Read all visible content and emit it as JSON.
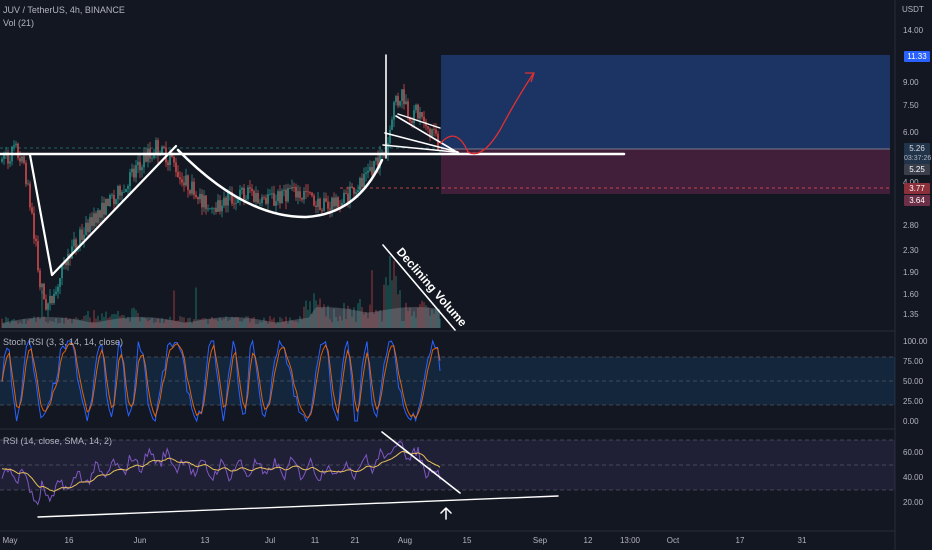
{
  "header": {
    "symbol": "JUV / TetherUS, 4h, BINANCE",
    "volume": "Vol (21)",
    "stoch": "Stoch RSI (3, 3, 14, 14, close)",
    "rsi": "RSI (14, close, SMA, 14, 2)",
    "currency": "USDT"
  },
  "annotations": {
    "declining_volume": "Declining Volume"
  },
  "price_tags": {
    "target": "11.33",
    "current": "5.26",
    "countdown": "03:37:26",
    "entry": "5.25",
    "stop": "3.77",
    "stop_low": "3.64"
  },
  "colors": {
    "background": "#131722",
    "up": "#26a69a",
    "down": "#ef5350",
    "profit_zone": "#1f3a6e",
    "loss_zone": "#4a2140",
    "annotation": "#ffffff",
    "arrow": "#e03030"
  },
  "chart_data": {
    "type": "line",
    "price_axis": {
      "scale": "log",
      "ticks": [
        "14.00",
        "9.00",
        "7.50",
        "6.00",
        "4.00",
        "2.80",
        "2.30",
        "1.90",
        "1.60",
        "1.35"
      ]
    },
    "stoch_axis": {
      "ticks": [
        "100.00",
        "75.00",
        "50.00",
        "25.00",
        "0.00"
      ],
      "ylim": [
        0,
        100
      ],
      "bands": [
        20,
        80
      ]
    },
    "rsi_axis": {
      "ticks": [
        "60.00",
        "40.00",
        "20.00"
      ],
      "bands": [
        30,
        70
      ]
    },
    "time_axis": [
      "May",
      "16",
      "Jun",
      "13",
      "Jul",
      "11",
      "21",
      "Aug",
      "15",
      "Sep",
      "12",
      "13:00",
      "Oct",
      "17",
      "31"
    ],
    "price_path": [
      [
        0,
        4.9
      ],
      [
        2,
        5.3
      ],
      [
        3,
        4.6
      ],
      [
        4,
        3.3
      ],
      [
        5,
        2.2
      ],
      [
        6,
        1.9
      ],
      [
        8,
        2.5
      ],
      [
        10,
        3.0
      ],
      [
        12,
        3.4
      ],
      [
        14,
        3.8
      ],
      [
        16,
        4.2
      ],
      [
        18,
        4.8
      ],
      [
        20,
        5.4
      ],
      [
        22,
        4.9
      ],
      [
        24,
        4.3
      ],
      [
        26,
        3.8
      ],
      [
        28,
        3.7
      ],
      [
        30,
        3.9
      ],
      [
        32,
        4.0
      ],
      [
        34,
        3.8
      ],
      [
        36,
        3.9
      ],
      [
        38,
        4.0
      ],
      [
        40,
        3.9
      ],
      [
        42,
        3.7
      ],
      [
        44,
        3.8
      ],
      [
        46,
        4.1
      ],
      [
        48,
        4.6
      ],
      [
        50,
        5.3
      ],
      [
        51,
        7.0
      ],
      [
        52,
        7.6
      ],
      [
        53,
        6.5
      ],
      [
        54,
        6.8
      ],
      [
        55,
        6.0
      ],
      [
        56,
        5.9
      ],
      [
        57,
        5.4
      ]
    ]
  }
}
